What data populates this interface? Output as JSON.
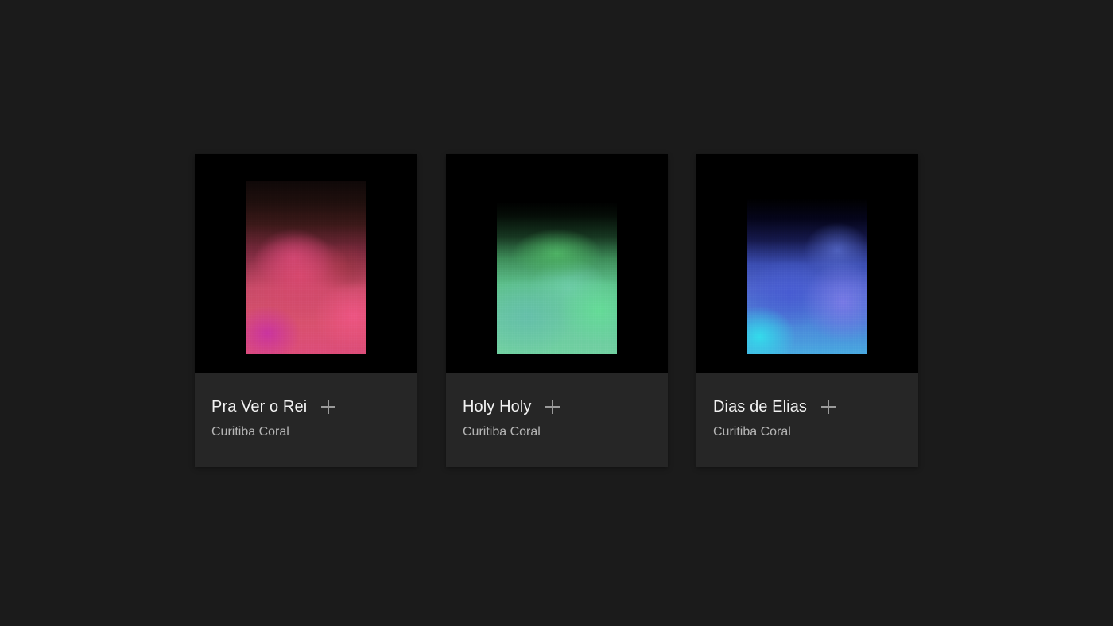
{
  "albums": [
    {
      "title": "Pra Ver o Rei",
      "artist": "Curitiba Coral",
      "cover_colors": [
        "#dc4c78",
        "#c84a67",
        "#c832a0"
      ]
    },
    {
      "title": "Holy Holy",
      "artist": "Curitiba Coral",
      "cover_colors": [
        "#4eb464",
        "#64dc96",
        "#64bea8"
      ]
    },
    {
      "title": "Dias de Elias",
      "artist": "Curitiba Coral",
      "cover_colors": [
        "#32dceb",
        "#7878e6",
        "#465ad2"
      ]
    }
  ],
  "icons": {
    "add": "plus-icon"
  },
  "colors": {
    "background": "#1b1b1b",
    "card": "#262626",
    "cover": "#000000",
    "title": "#f2f2f2",
    "artist": "#b5b5b5"
  }
}
